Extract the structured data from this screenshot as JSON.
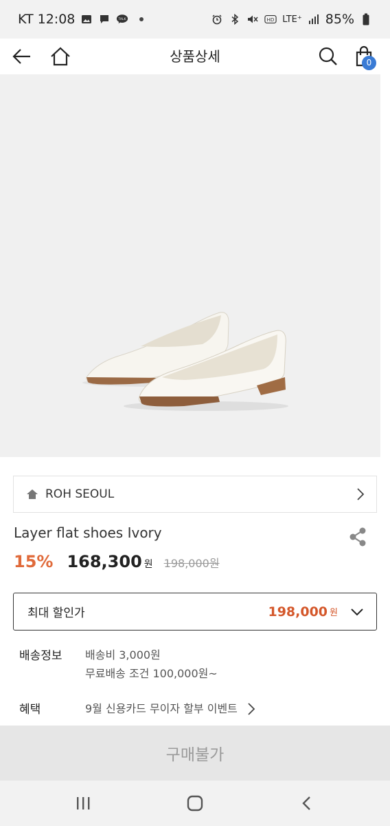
{
  "status_bar": {
    "carrier_time": "KT 12:08",
    "battery": "85%",
    "lte": "LTE⁺"
  },
  "header": {
    "title": "상품상세",
    "cart_count": "0"
  },
  "brand": {
    "name": "ROH SEOUL"
  },
  "product": {
    "name": "Layer flat shoes Ivory",
    "discount_rate": "15%",
    "sale_price": "168,300",
    "sale_unit": "원",
    "original_price": "198,000원"
  },
  "max_discount": {
    "label": "최대 할인가",
    "value": "198,000",
    "unit": "원"
  },
  "shipping": {
    "label": "배송정보",
    "fee": "배송비 3,000원",
    "free_condition": "무료배송 조건 100,000원~"
  },
  "benefit": {
    "label": "혜택",
    "text": "9월 신용카드 무이자 할부 이벤트"
  },
  "buy_button": {
    "label": "구매불가"
  },
  "colors": {
    "discount": "#e06a3a",
    "max_discount_value": "#d4572a",
    "cart_badge": "#3a7bd5",
    "buy_disabled_bg": "#e6e6e6"
  },
  "icons": [
    "photo-icon",
    "message-icon",
    "talk-icon",
    "alarm-icon",
    "bluetooth-icon",
    "mute-icon",
    "hd-icon",
    "signal-icon",
    "battery-icon",
    "back-arrow-icon",
    "home-icon",
    "search-icon",
    "cart-icon",
    "brand-home-icon",
    "chevron-right-icon",
    "share-icon",
    "chevron-down-icon",
    "recent-apps-icon",
    "home-nav-icon",
    "back-nav-icon"
  ]
}
